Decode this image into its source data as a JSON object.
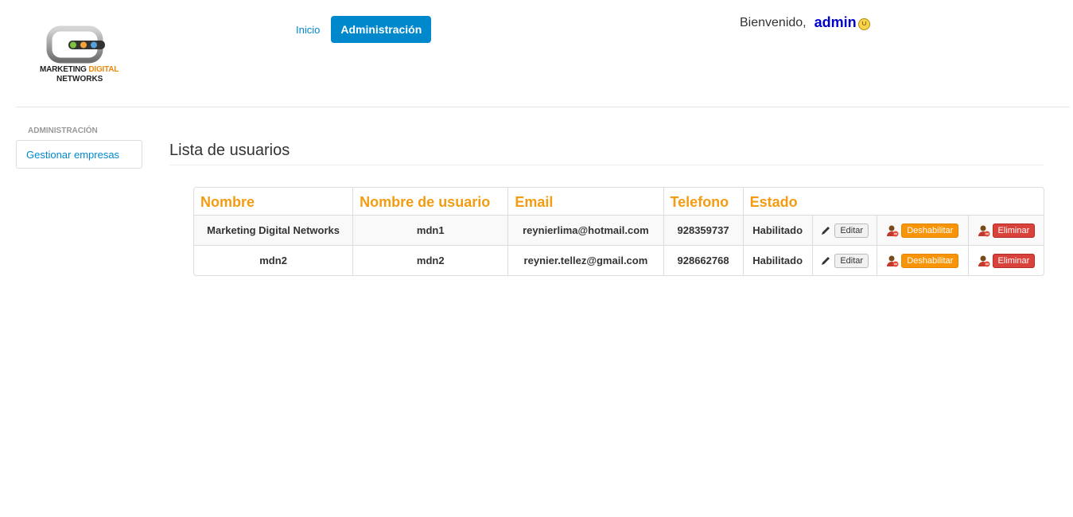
{
  "logo": {
    "line1_part1": "MARKETING",
    "line1_part2": "DIGITAL",
    "line2": "NETWORKS"
  },
  "nav": {
    "items": [
      {
        "label": "Inicio"
      },
      {
        "label": "Administración"
      }
    ]
  },
  "welcome": {
    "greeting": "Bienvenido,",
    "user": "admin",
    "icon": "power-icon"
  },
  "sidebar": {
    "header": "Administración",
    "items": [
      {
        "label": "Gestionar empresas"
      }
    ]
  },
  "main": {
    "title": "Lista de usuarios",
    "table": {
      "columns": [
        "Nombre",
        "Nombre de usuario",
        "Email",
        "Telefono",
        "Estado"
      ],
      "rows": [
        {
          "nombre": "Marketing Digital Networks",
          "usuario": "mdn1",
          "email": "reynierlima@hotmail.com",
          "telefono": "928359737",
          "estado": "Habilitado"
        },
        {
          "nombre": "mdn2",
          "usuario": "mdn2",
          "email": "reynier.tellez@gmail.com",
          "telefono": "928662768",
          "estado": "Habilitado"
        }
      ],
      "actions": {
        "edit": "Editar",
        "disable": "Deshabilitar",
        "delete": "Eliminar"
      }
    }
  },
  "colors": {
    "accent": "#0088cc",
    "header_orange": "#f39c12",
    "warning": "#f89406",
    "danger": "#d9413b",
    "user_link": "#0000cc"
  }
}
